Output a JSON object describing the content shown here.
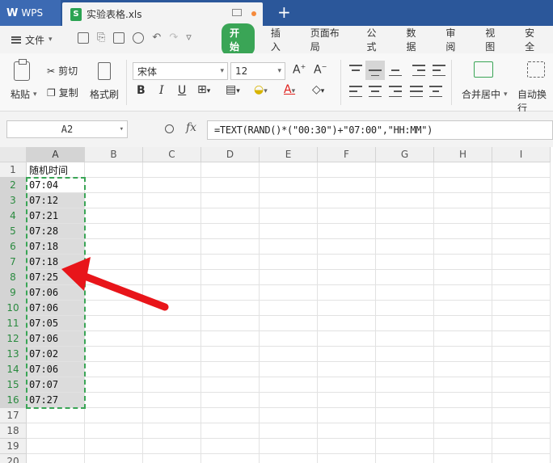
{
  "titlebar": {
    "app_name": "WPS",
    "doc_icon": "S",
    "doc_name": "实验表格.xls",
    "new_tab": "+"
  },
  "menubar": {
    "file": "文件",
    "tabs": [
      "开始",
      "插入",
      "页面布局",
      "公式",
      "数据",
      "审阅",
      "视图",
      "安全"
    ]
  },
  "ribbon": {
    "paste": "粘贴",
    "cut": "剪切",
    "copy": "复制",
    "format_painter": "格式刷",
    "font_name": "宋体",
    "font_size": "12",
    "bold": "B",
    "italic": "I",
    "underline": "U",
    "merge_center": "合并居中",
    "wrap_text": "自动换行"
  },
  "formula_bar": {
    "cell_ref": "A2",
    "fx": "fx",
    "formula": "=TEXT(RAND()*(\"00:30\")+\"07:00\",\"HH:MM\")"
  },
  "sheet": {
    "columns": [
      "A",
      "B",
      "C",
      "D",
      "E",
      "F",
      "G",
      "H",
      "I"
    ],
    "rows": [
      "1",
      "2",
      "3",
      "4",
      "5",
      "6",
      "7",
      "8",
      "9",
      "10",
      "11",
      "12",
      "13",
      "14",
      "15",
      "16",
      "17",
      "18",
      "19",
      "20"
    ],
    "header_cell": "随机时间",
    "values": [
      "07:04",
      "07:12",
      "07:21",
      "07:28",
      "07:18",
      "07:18",
      "07:25",
      "07:06",
      "07:06",
      "07:05",
      "07:06",
      "07:02",
      "07:06",
      "07:07",
      "07:27"
    ]
  },
  "colors": {
    "accent": "#3aa556",
    "titlebar": "#2b579a",
    "arrow": "#e8151a"
  }
}
